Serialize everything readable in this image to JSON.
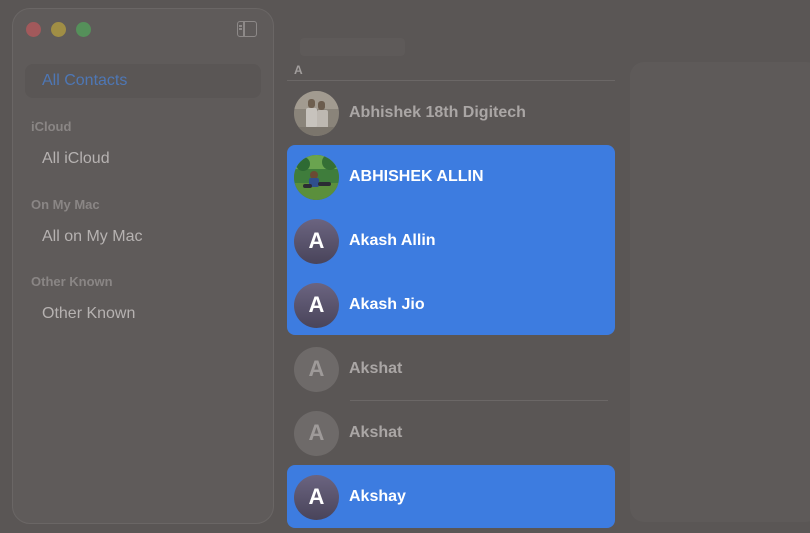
{
  "sidebar": {
    "items": [
      {
        "label": "All Contacts",
        "active": true
      },
      {
        "header": "iCloud"
      },
      {
        "label": "All iCloud"
      },
      {
        "header": "On My Mac"
      },
      {
        "label": "All on My Mac"
      },
      {
        "header": "Other Known"
      },
      {
        "label": "Other Known"
      }
    ]
  },
  "list": {
    "section": "A",
    "contacts": [
      {
        "name": "Abhishek 18th Digitech",
        "avatar": "photo",
        "selected": false
      },
      {
        "name": "ABHISHEK ALLIN",
        "avatar": "photo",
        "selected": true
      },
      {
        "name": "Akash Allin",
        "avatar_letter": "A",
        "selected": true
      },
      {
        "name": "Akash Jio",
        "avatar_letter": "A",
        "selected": true
      },
      {
        "name": "Akshat",
        "avatar_letter": "A",
        "selected": false
      },
      {
        "name": "Akshat",
        "avatar_letter": "A",
        "selected": false
      },
      {
        "name": "Akshay",
        "avatar_letter": "A",
        "selected": true
      }
    ]
  },
  "colors": {
    "selection": "#3d7ce0",
    "accent": "#4e77b5"
  }
}
